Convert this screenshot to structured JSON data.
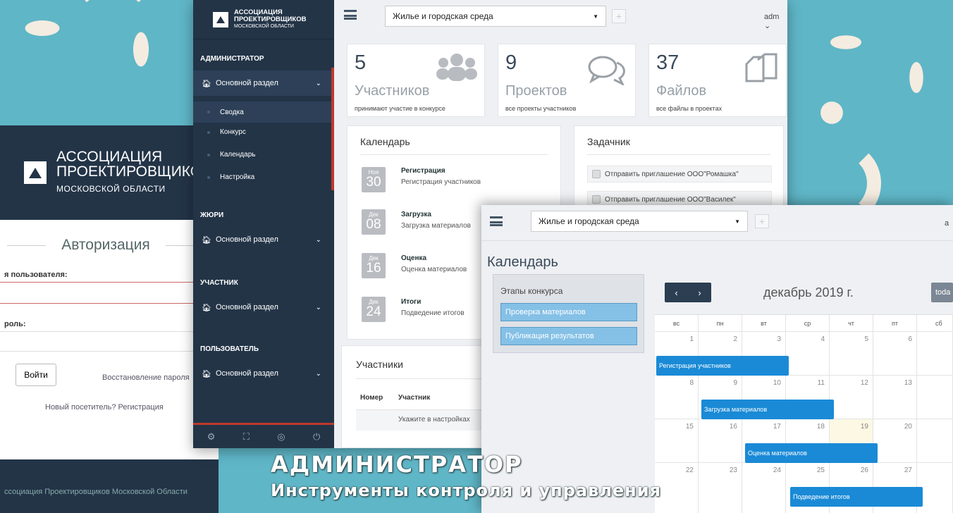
{
  "login": {
    "brand_line1": "АССОЦИАЦИЯ",
    "brand_line2": "ПРОЕКТИРОВЩИКОВ",
    "brand_line3": "МОСКОВСКОЙ ОБЛАСТИ",
    "title": "Авторизация",
    "username_label": "я пользователя:",
    "password_label": "роль:",
    "login_button": "Войти",
    "restore_link": "Восстановление пароля",
    "register_link": "Новый посетитель? Регистрация",
    "footer": "ссоциация Проектировщиков Московской Области"
  },
  "sidebar": {
    "logo_line1": "АССОЦИАЦИЯ",
    "logo_line2": "ПРОЕКТИРОВЩИКОВ",
    "logo_line3": "МОСКОВСКОЙ ОБЛАСТИ",
    "sections": [
      {
        "title": "АДМИНИСТРАТОР",
        "item": "Основной раздел",
        "subitems": [
          "Сводка",
          "Конкурс",
          "Календарь",
          "Настройка"
        ]
      },
      {
        "title": "ЖЮРИ",
        "item": "Основной раздел"
      },
      {
        "title": "УЧАСТНИК",
        "item": "Основной раздел"
      },
      {
        "title": "ПОЛЬЗОВАТЕЛЬ",
        "item": "Основной раздел"
      }
    ],
    "footer_icons": [
      "gear-icon",
      "fullscreen-icon",
      "eye-off-icon",
      "power-icon"
    ]
  },
  "topbar": {
    "select_value": "Жилье и городская среда",
    "user": "adm",
    "plus": "+"
  },
  "stats": [
    {
      "num": "5",
      "label": "Участников",
      "sub": "принимают участие в конкурсе",
      "icon": "users-icon"
    },
    {
      "num": "9",
      "label": "Проектов",
      "sub": "все проекты участников",
      "icon": "comments-icon"
    },
    {
      "num": "37",
      "label": "Файлов",
      "sub": "все файлы в проектах",
      "icon": "files-icon"
    }
  ],
  "calendar_card": {
    "title": "Календарь",
    "events": [
      {
        "month": "Ноя",
        "day": "30",
        "title": "Регистрация",
        "sub": "Регистрация участников"
      },
      {
        "month": "Дек",
        "day": "08",
        "title": "Загрузка",
        "sub": "Загрузка материалов"
      },
      {
        "month": "Дек",
        "day": "16",
        "title": "Оценка",
        "sub": "Оценка материалов"
      },
      {
        "month": "Дек",
        "day": "24",
        "title": "Итоги",
        "sub": "Подведение итогов"
      }
    ]
  },
  "tasks_card": {
    "title": "Задачник",
    "tasks": [
      "Отправить приглашение ООО\"Ромашка\"",
      "Отправить приглашение ООО\"Василек\""
    ]
  },
  "participants_card": {
    "title": "Участники",
    "col_num": "Номер",
    "col_name": "Участник",
    "empty": "Укажите в настройках"
  },
  "calendar_window": {
    "select_value": "Жилье и городская среда",
    "plus": "+",
    "user": "a",
    "title": "Календарь",
    "stages_title": "Этапы конкурса",
    "stages": [
      "Проверка материалов",
      "Публикация результатов"
    ],
    "prev": "‹",
    "next": "›",
    "month": "декабрь 2019 г.",
    "today": "toda",
    "dow": [
      "вс",
      "пн",
      "вт",
      "ср",
      "чт",
      "пт",
      "сб"
    ],
    "weeks": [
      [
        "1",
        "2",
        "3",
        "4",
        "5",
        "6"
      ],
      [
        "8",
        "9",
        "10",
        "11",
        "12",
        "13"
      ],
      [
        "15",
        "16",
        "17",
        "18",
        "19",
        "20"
      ],
      [
        "22",
        "23",
        "24",
        "25",
        "26",
        "27"
      ]
    ],
    "events": [
      "Регистрация участников",
      "Загрузка материалов",
      "Оценка материалов",
      "Подведение итогов"
    ]
  },
  "overlay": {
    "line1": "АДМИНИСТРАТОР",
    "line2": "Инструменты контроля и управления"
  },
  "colors": {
    "navy": "#233447",
    "accent_red": "#c0392b",
    "event_blue": "#1a8ad6",
    "bg_teal": "#5fb6c7"
  }
}
